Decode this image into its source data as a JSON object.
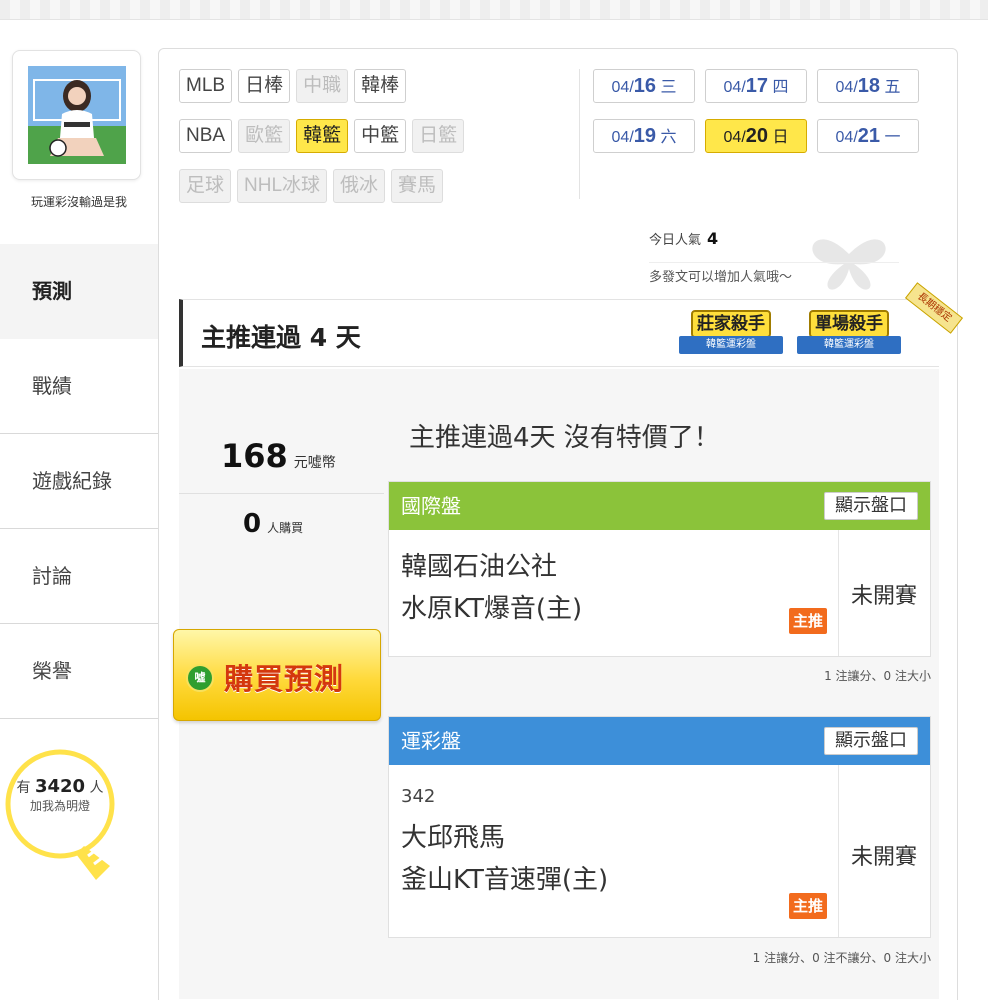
{
  "user": {
    "name": "玩運彩沒輸過是我",
    "avatar": "player-avatar"
  },
  "sidebar": {
    "items": [
      {
        "label": "預測",
        "active": true
      },
      {
        "label": "戰績"
      },
      {
        "label": "遊戲紀錄"
      },
      {
        "label": "討論"
      },
      {
        "label": "榮譽"
      }
    ],
    "fans": {
      "prefix": "有",
      "count": "3420",
      "unit": "人",
      "sub": "加我為明燈"
    }
  },
  "sports": {
    "row1": [
      {
        "label": "MLB",
        "state": "normal"
      },
      {
        "label": "日棒",
        "state": "normal"
      },
      {
        "label": "中職",
        "state": "disabled"
      },
      {
        "label": "韓棒",
        "state": "normal"
      }
    ],
    "row2": [
      {
        "label": "NBA",
        "state": "normal"
      },
      {
        "label": "歐籃",
        "state": "disabled"
      },
      {
        "label": "韓籃",
        "state": "selected"
      },
      {
        "label": "中籃",
        "state": "normal"
      },
      {
        "label": "日籃",
        "state": "disabled"
      }
    ],
    "row3": [
      {
        "label": "足球",
        "state": "disabled"
      },
      {
        "label": "NHL冰球",
        "state": "disabled"
      },
      {
        "label": "俄冰",
        "state": "disabled"
      },
      {
        "label": "賽馬",
        "state": "disabled"
      }
    ]
  },
  "dates": {
    "row1": [
      {
        "md": "04/",
        "d": "16",
        "wd": "三"
      },
      {
        "md": "04/",
        "d": "17",
        "wd": "四"
      },
      {
        "md": "04/",
        "d": "18",
        "wd": "五"
      }
    ],
    "row2": [
      {
        "md": "04/",
        "d": "19",
        "wd": "六"
      },
      {
        "md": "04/",
        "d": "20",
        "wd": "日",
        "selected": true
      },
      {
        "md": "04/",
        "d": "21",
        "wd": "一"
      }
    ]
  },
  "popularity": {
    "label": "今日人氣",
    "value": "4",
    "tip": "多發文可以增加人氣哦～"
  },
  "streak": {
    "title": "主推連過 4 天"
  },
  "badges": [
    {
      "title": "莊家殺手",
      "ribbon": "韓籃運彩盤"
    },
    {
      "title": "單場殺手",
      "ribbon": "韓籃運彩盤"
    }
  ],
  "long_tag": "長期穩定",
  "price": {
    "value": "168",
    "unit": "元噓幣"
  },
  "buyers": {
    "value": "0",
    "unit": "人購買"
  },
  "buy_button": {
    "coin": "噓",
    "label": "購買預測"
  },
  "promo": "主推連過4天 沒有特價了！",
  "picks": [
    {
      "market": "國際盤",
      "color": "#8bc33a",
      "show_label": "顯示盤口",
      "game_no": "",
      "team1": "韓國石油公社",
      "team2": "水原KT爆音(主)",
      "tag": "主推",
      "status": "未開賽",
      "note": "1 注讓分、0 注大小"
    },
    {
      "market": "運彩盤",
      "color": "#3d8fd9",
      "show_label": "顯示盤口",
      "game_no": "342",
      "team1": "大邱飛馬",
      "team2": "釜山KT音速彈(主)",
      "tag": "主推",
      "status": "未開賽",
      "note": "1 注讓分、0 注不讓分、0 注大小"
    }
  ]
}
